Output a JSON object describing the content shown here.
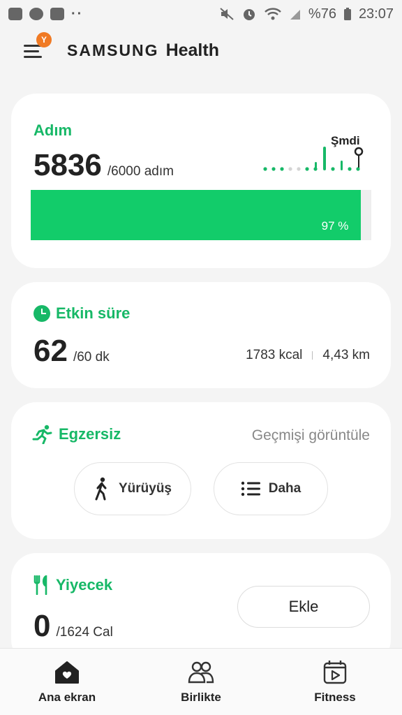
{
  "status_bar": {
    "battery_text": "%76",
    "time": "23:07",
    "left_icons": [
      "youtube-icon",
      "messenger-icon",
      "instagram-icon",
      "more-dots-icon"
    ],
    "right_icons": [
      "mute-icon",
      "alarm-icon",
      "wifi-icon",
      "signal-icon",
      "battery-icon"
    ]
  },
  "header": {
    "menu_badge": "Y",
    "brand_samsung": "SAMSUNG",
    "brand_health": "Health"
  },
  "steps": {
    "title": "Adım",
    "value": "5836",
    "goal_text": "/6000 adım",
    "now_label": "Şmdi",
    "progress_fraction": 0.97,
    "progress_label": "97 %"
  },
  "active_time": {
    "title": "Etkin süre",
    "value": "62",
    "goal_text": "/60 dk",
    "kcal": "1783 kcal",
    "distance": "4,43 km"
  },
  "exercise": {
    "title": "Egzersiz",
    "history_link": "Geçmişi görüntüle",
    "walk_label": "Yürüyüş",
    "more_label": "Daha"
  },
  "food": {
    "title": "Yiyecek",
    "value": "0",
    "goal_text": "/1624 Cal",
    "add_label": "Ekle"
  },
  "bottom_nav": {
    "home": "Ana ekran",
    "together": "Birlikte",
    "fitness": "Fitness"
  },
  "colors": {
    "accent_green": "#17b867",
    "progress_green": "#12cc6a",
    "badge_orange": "#f07a24",
    "background": "#f4f4f4"
  }
}
